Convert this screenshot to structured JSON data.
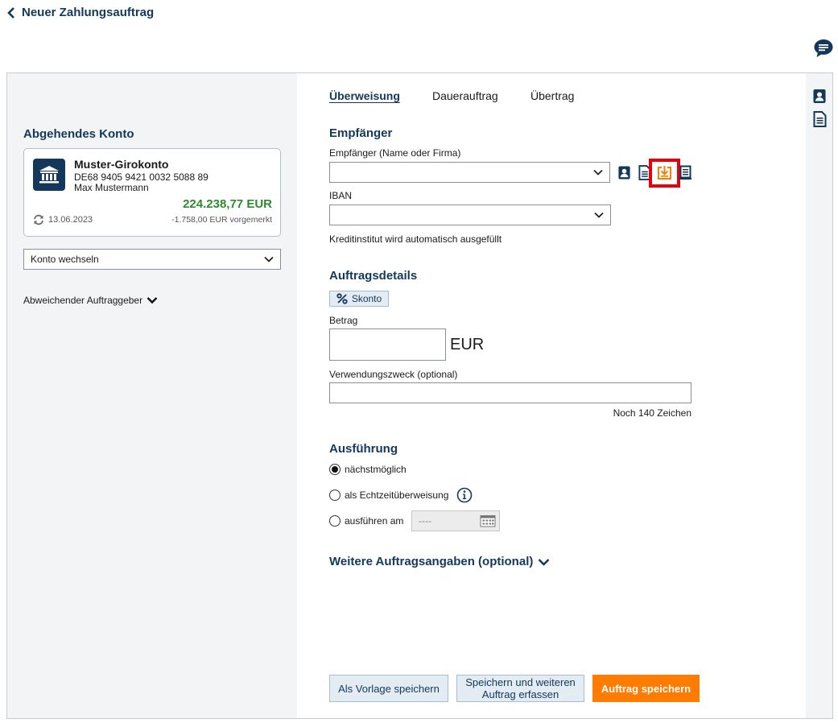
{
  "header": {
    "back_label": "Neuer Zahlungsauftrag"
  },
  "left": {
    "section_title": "Abgehendes Konto",
    "account": {
      "name": "Muster-Girokonto",
      "iban": "DE68 9405 9421 0032 5088 89",
      "holder": "Max Mustermann",
      "balance": "224.238,77 EUR",
      "date": "13.06.2023",
      "pending": "-1.758,00 EUR vorgemerkt"
    },
    "switch_account_label": "Konto wechseln",
    "alt_sender_label": "Abweichender Auftraggeber"
  },
  "tabs": [
    {
      "label": "Überweisung",
      "active": true
    },
    {
      "label": "Dauerauftrag",
      "active": false
    },
    {
      "label": "Übertrag",
      "active": false
    }
  ],
  "recipient": {
    "section_title": "Empfänger",
    "name_label": "Empfänger (Name oder Firma)",
    "name_value": "",
    "iban_label": "IBAN",
    "iban_value": "",
    "bank_hint": "Kreditinstitut wird automatisch ausgefüllt"
  },
  "details": {
    "section_title": "Auftragsdetails",
    "skonto_label": "Skonto",
    "amount_label": "Betrag",
    "amount_value": "",
    "currency": "EUR",
    "purpose_label": "Verwendungszweck (optional)",
    "purpose_value": "",
    "chars_left": "Noch 140 Zeichen"
  },
  "execution": {
    "section_title": "Ausführung",
    "options": [
      {
        "label": "nächstmöglich",
        "checked": true
      },
      {
        "label": "als Echtzeitüberweisung",
        "checked": false
      },
      {
        "label": "ausführen am",
        "checked": false
      }
    ],
    "date_placeholder": "----"
  },
  "more_info_label": "Weitere Auftragsangaben (optional)",
  "buttons": {
    "save_template": "Als Vorlage speichern",
    "save_and_new_line1": "Speichern und weiteren",
    "save_and_new_line2": "Auftrag erfassen",
    "save_order": "Auftrag speichern"
  },
  "colors": {
    "brand_navy": "#13385c",
    "accent_orange": "#ff7c00",
    "balance_green": "#2e8a2e",
    "highlight_red": "#e8000b"
  },
  "icons": {
    "back": "chevron-left-icon",
    "chat": "chat-bubble-icon",
    "bank": "bank-building-icon",
    "contacts": "address-book-icon",
    "document": "document-icon",
    "import": "download-tray-icon",
    "receipt": "receipt-icon",
    "info": "info-icon",
    "calendar": "calendar-icon"
  }
}
